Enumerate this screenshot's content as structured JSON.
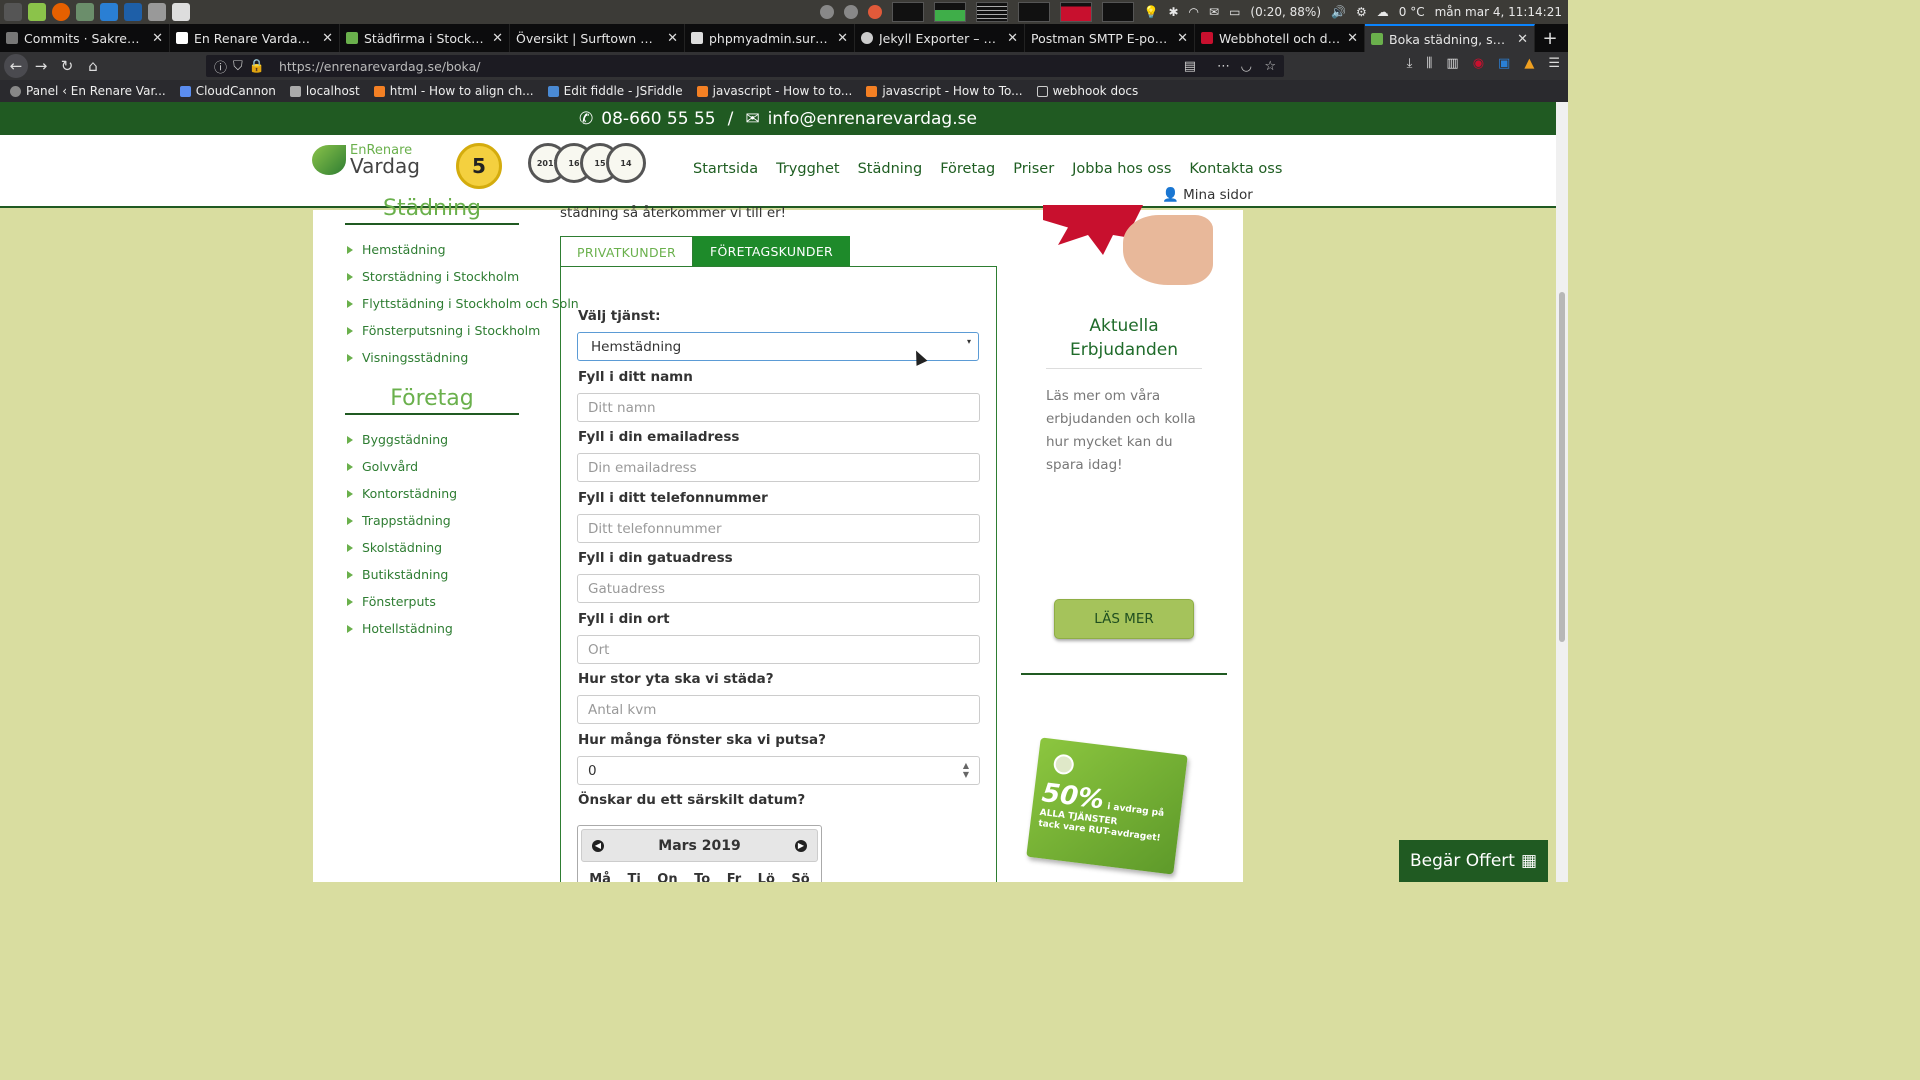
{
  "os_panel": {
    "battery": "(0:20, 88%)",
    "weather": "0 °C",
    "datetime": "mån mar 4, 11:14:21"
  },
  "tabs": [
    {
      "title": "Commits · Sakrecoer/t",
      "active": false
    },
    {
      "title": "En Renare Vardag | Tre",
      "active": false
    },
    {
      "title": "Städfirma i Stockholm",
      "active": false
    },
    {
      "title": "Översikt | Surftown Dash",
      "active": false
    },
    {
      "title": "phpmyadmin.surftow",
      "active": false
    },
    {
      "title": "Jekyll Exporter – Wor",
      "active": false
    },
    {
      "title": "Postman SMTP E-postlog",
      "active": false
    },
    {
      "title": "Webbhotell och domä",
      "active": false
    },
    {
      "title": "Boka städning, skicka",
      "active": true
    }
  ],
  "navbar": {
    "url": "https://enrenarevardag.se/boka/"
  },
  "bookmarks": [
    "Panel ‹ En Renare Var...",
    "CloudCannon",
    "localhost",
    "html - How to align ch...",
    "Edit fiddle - JSFiddle",
    "javascript - How to to...",
    "javascript - How to To...",
    "webhook docs"
  ],
  "site": {
    "phone": "08-660 55 55",
    "separator": "/",
    "email": "info@enrenarevardag.se",
    "logo_line1": "EnRenare",
    "logo_line2": "Vardag",
    "badge_number": "5",
    "nav": [
      "Startsida",
      "Trygghet",
      "Städning",
      "Företag",
      "Priser",
      "Jobba hos oss",
      "Kontakta oss"
    ],
    "my_pages": "Mina sidor"
  },
  "sidebar": {
    "section1_title": "Städning",
    "section1_items": [
      "Hemstädning",
      "Storstädning i Stockholm",
      "Flyttstädning i Stockholm och Soln",
      "Fönsterputsning i Stockholm",
      "Visningsstädning"
    ],
    "section2_title": "Företag",
    "section2_items": [
      "Byggstädning",
      "Golvvård",
      "Kontorstädning",
      "Trappstädning",
      "Skolstädning",
      "Butikstädning",
      "Fönsterputs",
      "Hotellstädning"
    ]
  },
  "form": {
    "intro_text": "städning så återkommer vi till er!",
    "tab_private": "PRIVATKUNDER",
    "tab_business": "FÖRETAGSKUNDER",
    "service_label": "Välj tjänst:",
    "service_value": "Hemstädning",
    "name_label": "Fyll i ditt namn",
    "name_placeholder": "Ditt namn",
    "email_label": "Fyll i din emailadress",
    "email_placeholder": "Din emailadress",
    "phone_label": "Fyll i ditt telefonnummer",
    "phone_placeholder": "Ditt telefonnummer",
    "street_label": "Fyll i din gatuadress",
    "street_placeholder": "Gatuadress",
    "city_label": "Fyll i din ort",
    "city_placeholder": "Ort",
    "area_label": "Hur stor yta ska vi städa?",
    "area_placeholder": "Antal kvm",
    "windows_label": "Hur många fönster ska vi putsa?",
    "windows_value": "0",
    "date_label": "Önskar du ett särskilt datum?",
    "calendar_month": "Mars 2019",
    "weekdays": [
      "Må",
      "Ti",
      "On",
      "To",
      "Fr",
      "Lö",
      "Sö"
    ]
  },
  "right": {
    "offer_title": "Aktuella Erbjudanden",
    "offer_text": "Läs mer om våra erbjudanden och kolla hur mycket kan du spara idag!",
    "read_more": "LÄS MER",
    "rut_percent": "50%",
    "rut_line1": "i avdrag på",
    "rut_line2": "ALLA TJÄNSTER",
    "rut_line3": "tack vare RUT-avdraget!"
  },
  "cta": {
    "label": "Begär Offert"
  },
  "colors": {
    "brand_green": "#205a22",
    "accent_green": "#6ab04c",
    "page_bg": "#d9dda0"
  }
}
